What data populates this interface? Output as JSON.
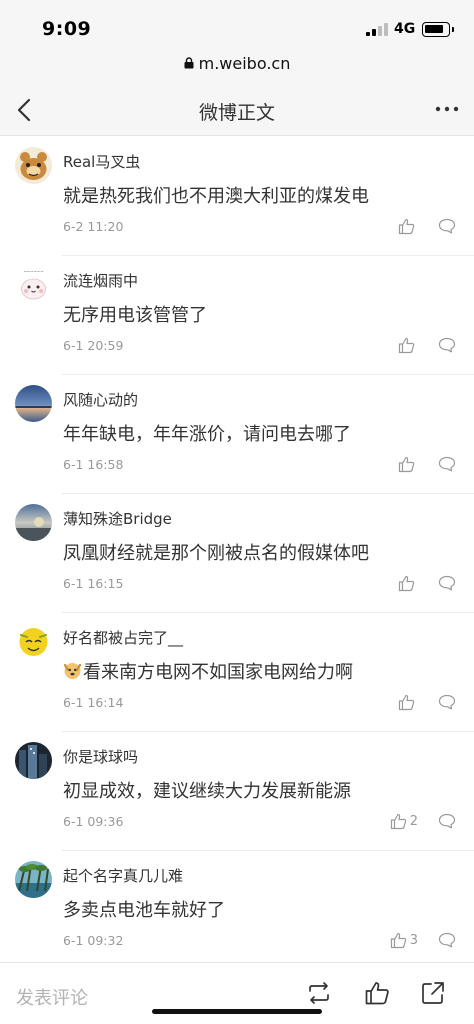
{
  "status_bar": {
    "time": "9:09",
    "network": "4G"
  },
  "browser": {
    "url": "m.weibo.cn"
  },
  "nav": {
    "title": "微博正文"
  },
  "comments": [
    {
      "user": "Real马叉虫",
      "text": "就是热死我们也不用澳大利亚的煤发电",
      "time": "6-2 11:20",
      "likes": ""
    },
    {
      "user": "流连烟雨中",
      "text": "无序用电该管管了",
      "time": "6-1 20:59",
      "likes": ""
    },
    {
      "user": "风随心动的",
      "text": "年年缺电，年年涨价，请问电去哪了",
      "time": "6-1 16:58",
      "likes": ""
    },
    {
      "user": "薄知殊途Bridge",
      "text": "凤凰财经就是那个刚被点名的假媒体吧",
      "time": "6-1 16:15",
      "likes": ""
    },
    {
      "user": "好名都被占完了__",
      "text": "看来南方电网不如国家电网给力啊",
      "time": "6-1 16:14",
      "likes": ""
    },
    {
      "user": "你是球球吗",
      "text": "初显成效，建议继续大力发展新能源",
      "time": "6-1 09:36",
      "likes": "2"
    },
    {
      "user": "起个名字真几儿难",
      "text": "多卖点电池车就好了",
      "time": "6-1 09:32",
      "likes": "3"
    }
  ],
  "bottom_bar": {
    "compose_placeholder": "发表评论"
  },
  "colors": {
    "background": "#ffffff",
    "header_bg": "#f6f6f6",
    "text": "#333333",
    "muted": "#999999"
  }
}
